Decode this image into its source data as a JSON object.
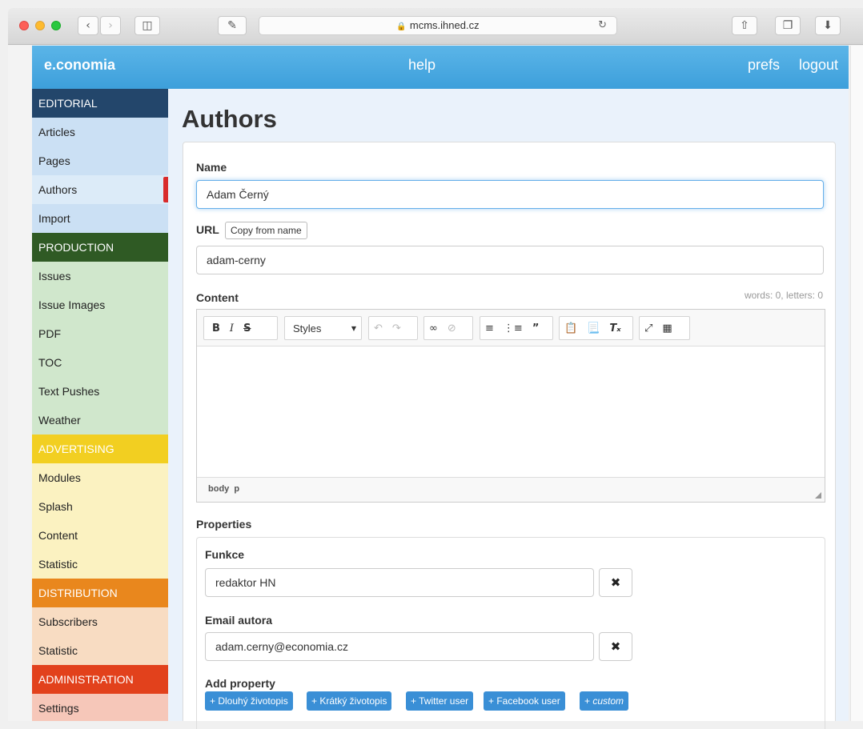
{
  "browser": {
    "url": "mcms.ihned.cz"
  },
  "appbar": {
    "brand": "e.conomia",
    "help": "help",
    "prefs": "prefs",
    "logout": "logout"
  },
  "sidebar": {
    "editorial": {
      "header": "EDITORIAL",
      "items": [
        "Articles",
        "Pages",
        "Authors",
        "Import"
      ]
    },
    "production": {
      "header": "PRODUCTION",
      "items": [
        "Issues",
        "Issue Images",
        "PDF",
        "TOC",
        "Text Pushes",
        "Weather"
      ]
    },
    "advertising": {
      "header": "ADVERTISING",
      "items": [
        "Modules",
        "Splash",
        "Content",
        "Statistic"
      ]
    },
    "distribution": {
      "header": "DISTRIBUTION",
      "items": [
        "Subscribers",
        "Statistic"
      ]
    },
    "administration": {
      "header": "ADMINISTRATION",
      "items": [
        "Settings"
      ]
    },
    "active": "Authors"
  },
  "main": {
    "title": "Authors",
    "name_label": "Name",
    "name_value": "Adam Černý",
    "url_label": "URL",
    "copy_button": "Copy from name",
    "url_value": "adam-cerny",
    "content_label": "Content",
    "word_count": "words: 0, letters: 0",
    "editor": {
      "styles": "Styles",
      "status_path": [
        "body",
        "p"
      ]
    },
    "properties_label": "Properties",
    "funkce_label": "Funkce",
    "funkce_value": "redaktor HN",
    "email_label": "Email autora",
    "email_value": "adam.cerny@economia.cz",
    "add_property_label": "Add property",
    "add_buttons": [
      "Dlouhý životopis",
      "Krátký životopis",
      "Twitter user",
      "Facebook user",
      "custom"
    ]
  },
  "colors": {
    "appbar": "#3d9fdb",
    "editorial": "#23466b",
    "production": "#2f5a24",
    "advertising": "#f2cf21",
    "distribution": "#e9871d",
    "administration": "#e2411c",
    "pill": "#3a8fd6",
    "active_marker": "#d92b2b"
  }
}
